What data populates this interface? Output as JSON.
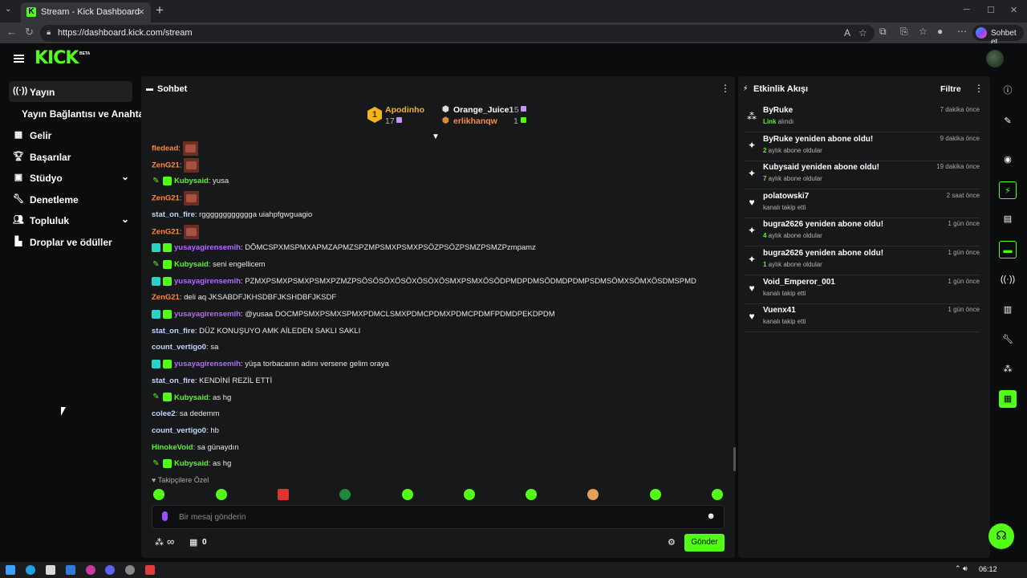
{
  "browser": {
    "tab_title": "Stream - Kick Dashboard",
    "url": "https://dashboard.kick.com/stream",
    "copilot_label": "Sohbet et"
  },
  "header": {
    "logo": "KICK",
    "beta": "BETA"
  },
  "sidebar": {
    "items": [
      {
        "label": "Yayın",
        "icon": "broadcast-icon"
      },
      {
        "label": "Yayın Bağlantısı ve Anahtarı",
        "icon": ""
      },
      {
        "label": "Gelir",
        "icon": "chart-icon"
      },
      {
        "label": "Başarılar",
        "icon": "trophy-icon"
      },
      {
        "label": "Stüdyo",
        "icon": "studio-icon"
      },
      {
        "label": "Denetleme",
        "icon": "wrench-icon"
      },
      {
        "label": "Topluluk",
        "icon": "people-icon"
      },
      {
        "label": "Droplar ve ödüller",
        "icon": "drops-icon"
      }
    ]
  },
  "chat": {
    "title": "Sohbet",
    "top_gifters": [
      {
        "rank": "1",
        "name": "Apodinho",
        "count": "17"
      },
      {
        "rank": "2",
        "name": "Orange_Juice1",
        "count": "15"
      },
      {
        "rank": "3",
        "name": "erlikhanqw",
        "count": "1"
      }
    ],
    "messages": [
      {
        "user": "fledead",
        "color": "#ff8a3d",
        "text": "",
        "emote": true
      },
      {
        "user": "ZenG21",
        "color": "#ff8a3d",
        "text": "",
        "emote": true
      },
      {
        "user": "Kubysaid",
        "color": "#53fc18",
        "text": "yusa",
        "badges": "mod,sub"
      },
      {
        "user": "ZenG21",
        "color": "#ff8a3d",
        "text": "",
        "emote": true
      },
      {
        "user": "stat_on_fire",
        "color": "#c3d7ff",
        "text": "rgggggggggggga uiahpfgwguagio"
      },
      {
        "user": "ZenG21",
        "color": "#ff8a3d",
        "text": "",
        "emote": true
      },
      {
        "user": "yusayagirensemih",
        "color": "#b26bff",
        "text": "DÕMCSPXMSPMXAPMZAPMZSPZMPSMXPSMXPSÖZPSÖZPSMZPSMZPzmpamz",
        "badges": "sub2,gift"
      },
      {
        "user": "Kubysaid",
        "color": "#53fc18",
        "text": "seni engellicem",
        "badges": "mod,sub"
      },
      {
        "user": "yusayagirensemih",
        "color": "#b26bff",
        "text": "PZMXPSMXPSMXPSMXPZMZPSÖSÖSÖXÖSÖXÖSÖXÖSMXPSMXÖSÖDPMDPDMSÖDMDPDMPSDMSÖMXSÖMXÖSDMSPMD",
        "badges": "sub2,gift"
      },
      {
        "user": "ZenG21",
        "color": "#ff8a3d",
        "text": "deli aq JKSABDFJKHSDBFJKSHDBFJKSDF"
      },
      {
        "user": "yusayagirensemih",
        "color": "#b26bff",
        "text": "@yusaa DOCMPSMXPSMXSPMXPDMCLSMXPDMCPDMXPDMCPDMFPDMDPEKDPDM",
        "badges": "sub2,gift"
      },
      {
        "user": "stat_on_fire",
        "color": "#c3d7ff",
        "text": "DÜZ KONUŞUYO AMK AİLEDEN SAKLI SAKLI"
      },
      {
        "user": "count_vertigo0",
        "color": "#c3d7ff",
        "text": "sa"
      },
      {
        "user": "yusayagirensemih",
        "color": "#b26bff",
        "text": "yüşa torbacanın adını versene gelim oraya",
        "badges": "sub2,gift"
      },
      {
        "user": "stat_on_fire",
        "color": "#c3d7ff",
        "text": "KENDİNİ REZİL ETTİ"
      },
      {
        "user": "Kubysaid",
        "color": "#53fc18",
        "text": "as hg",
        "badges": "mod,sub"
      },
      {
        "user": "colee2",
        "color": "#c3d7ff",
        "text": "sa dedemm"
      },
      {
        "user": "count_vertigo0",
        "color": "#c3d7ff",
        "text": "hb"
      },
      {
        "user": "HinokeVoid",
        "color": "#53fc18",
        "text": "sa günaydın"
      },
      {
        "user": "Kubysaid",
        "color": "#53fc18",
        "text": "as hg",
        "badges": "mod,sub"
      }
    ],
    "followers_only": "Takipçilere Özel",
    "input_placeholder": "Bir mesaj gönderin",
    "infinity": "∞",
    "gift_count": "0",
    "send_label": "Gönder"
  },
  "activity": {
    "title": "Etkinlik Akışı",
    "filter_label": "Filtre",
    "events": [
      {
        "icon": "drops-icon",
        "title": "ByRuke",
        "hl": "Link",
        "sub": " alındı",
        "time": "7 dakika önce"
      },
      {
        "icon": "sparkle-icon",
        "title": "ByRuke yeniden abone oldu!",
        "hl": "2",
        "sub": " aylık abone oldular",
        "time": "9 dakika önce"
      },
      {
        "icon": "sparkle-icon",
        "title": "Kubysaid yeniden abone oldu!",
        "hl": "7",
        "sub": " aylık abone oldular",
        "time": "19 dakika önce"
      },
      {
        "icon": "heart-icon",
        "title": "polatowski7",
        "hl": "",
        "sub": "kanalı takip etti",
        "time": "2 saat önce"
      },
      {
        "icon": "sparkle-icon",
        "title": "bugra2626 yeniden abone oldu!",
        "hl": "4",
        "sub": " aylık abone oldular",
        "time": "1 gün önce"
      },
      {
        "icon": "sparkle-icon",
        "title": "bugra2626 yeniden abone oldu!",
        "hl": "1",
        "sub": " aylık abone oldular",
        "time": "1 gün önce"
      },
      {
        "icon": "heart-icon",
        "title": "Void_Emperor_001",
        "hl": "",
        "sub": "kanalı takip etti",
        "time": "1 gün önce"
      },
      {
        "icon": "heart-icon",
        "title": "Vuenx41",
        "hl": "",
        "sub": "kanalı takip etti",
        "time": "1 gün önce"
      }
    ]
  },
  "taskbar": {
    "time": "06:12"
  },
  "colors": {
    "accent": "#53fc18",
    "panel": "#17181a",
    "bg": "#0b0c0d"
  }
}
